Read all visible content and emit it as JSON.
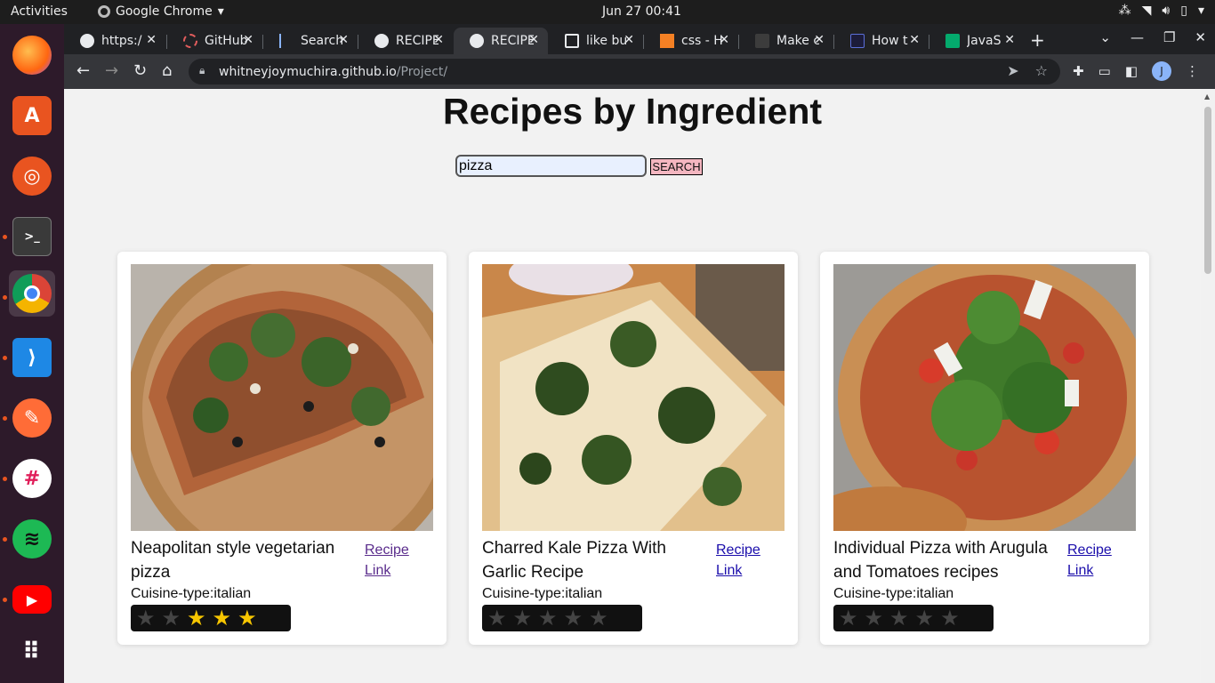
{
  "system": {
    "activities": "Activities",
    "app_name": "Google Chrome",
    "clock": "Jun 27  00:41"
  },
  "tabs": [
    {
      "title": "https:/",
      "favicon_color": "#e8eaed",
      "active": false
    },
    {
      "title": "GitHub",
      "favicon_color": "#e25d5d",
      "active": false
    },
    {
      "title": "Search",
      "favicon_color": "#8ab4f8",
      "active": false
    },
    {
      "title": "RECIPE",
      "favicon_color": "#e8eaed",
      "active": false
    },
    {
      "title": "RECIPE",
      "favicon_color": "#e8eaed",
      "active": true
    },
    {
      "title": "like bu",
      "favicon_color": "#e8eaed",
      "active": false
    },
    {
      "title": "css - H",
      "favicon_color": "#f48024",
      "active": false
    },
    {
      "title": "Make c",
      "favicon_color": "#3c3c3c",
      "active": false
    },
    {
      "title": "How t",
      "favicon_color": "#5b6fd8",
      "active": false
    },
    {
      "title": "JavaS",
      "favicon_color": "#04aa6d",
      "active": false
    }
  ],
  "address_bar": {
    "host": "whitneyjoymuchira.github.io",
    "path": "/Project/"
  },
  "profile_initial": "J",
  "page": {
    "title": "Recipes by Ingredient",
    "search_value": "pizza",
    "search_button": "SEARCH"
  },
  "recipes": [
    {
      "title": "Neapolitan style vegetarian pizza",
      "link_label": "Recipe Link",
      "cuisine": "Cuisine-type:italian",
      "rating": 3,
      "max_rating": 5,
      "link_visited": true
    },
    {
      "title": "Charred Kale Pizza With Garlic Recipe",
      "link_label": "Recipe Link",
      "cuisine": "Cuisine-type:italian",
      "rating": 0,
      "max_rating": 5,
      "link_visited": false
    },
    {
      "title": "Individual Pizza with Arugula and Tomatoes recipes",
      "link_label": "Recipe Link",
      "cuisine": "Cuisine-type:italian",
      "rating": 0,
      "max_rating": 5,
      "link_visited": false
    }
  ],
  "colors": {
    "star_on": "#f7c600",
    "star_off": "#444444",
    "search_button_bg": "#f4b6c0"
  }
}
